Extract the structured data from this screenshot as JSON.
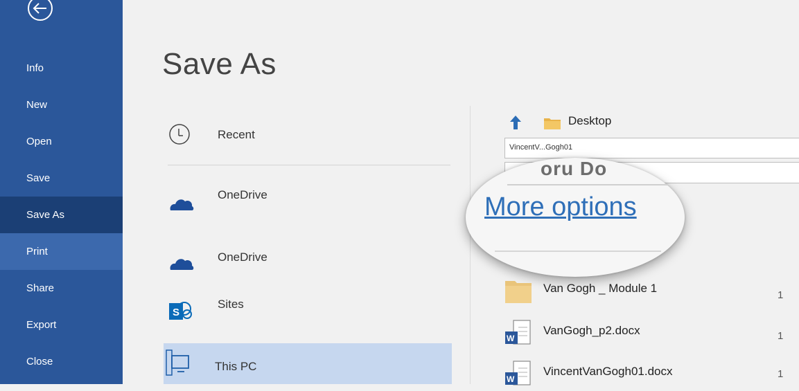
{
  "sidebar": {
    "items": [
      {
        "label": "Info"
      },
      {
        "label": "New"
      },
      {
        "label": "Open"
      },
      {
        "label": "Save"
      },
      {
        "label": "Save As"
      },
      {
        "label": "Print"
      },
      {
        "label": "Share"
      },
      {
        "label": "Export"
      },
      {
        "label": "Close"
      }
    ],
    "selected": "Save As",
    "hovered": "Print"
  },
  "page": {
    "title": "Save As"
  },
  "places": [
    {
      "label": "Recent",
      "icon": "clock-icon"
    },
    {
      "label": "OneDrive",
      "icon": "onedrive-cloud-icon"
    },
    {
      "label": "OneDrive",
      "icon": "onedrive-cloud-icon"
    },
    {
      "label": "Sites",
      "icon": "sharepoint-icon"
    },
    {
      "label": "This PC",
      "icon": "computer-icon"
    }
  ],
  "location": {
    "folder": "Desktop"
  },
  "filename": {
    "value": "VincentV...Gogh01"
  },
  "magnifier": {
    "faint_text": "oru Do",
    "link": "More options"
  },
  "files": [
    {
      "name": "Van Gogh _ Module 1",
      "type": "folder",
      "date": "1"
    },
    {
      "name": "VanGogh_p2.docx",
      "type": "word",
      "date": "1"
    },
    {
      "name": "VincentVanGogh01.docx",
      "type": "word",
      "date": "1"
    }
  ],
  "colors": {
    "sidebar": "#2b579a",
    "sidebar_selected": "#1b3f75",
    "sidebar_hover": "#3c69ad",
    "link": "#2f6fb8",
    "selected_place": "#c6d7ef"
  }
}
